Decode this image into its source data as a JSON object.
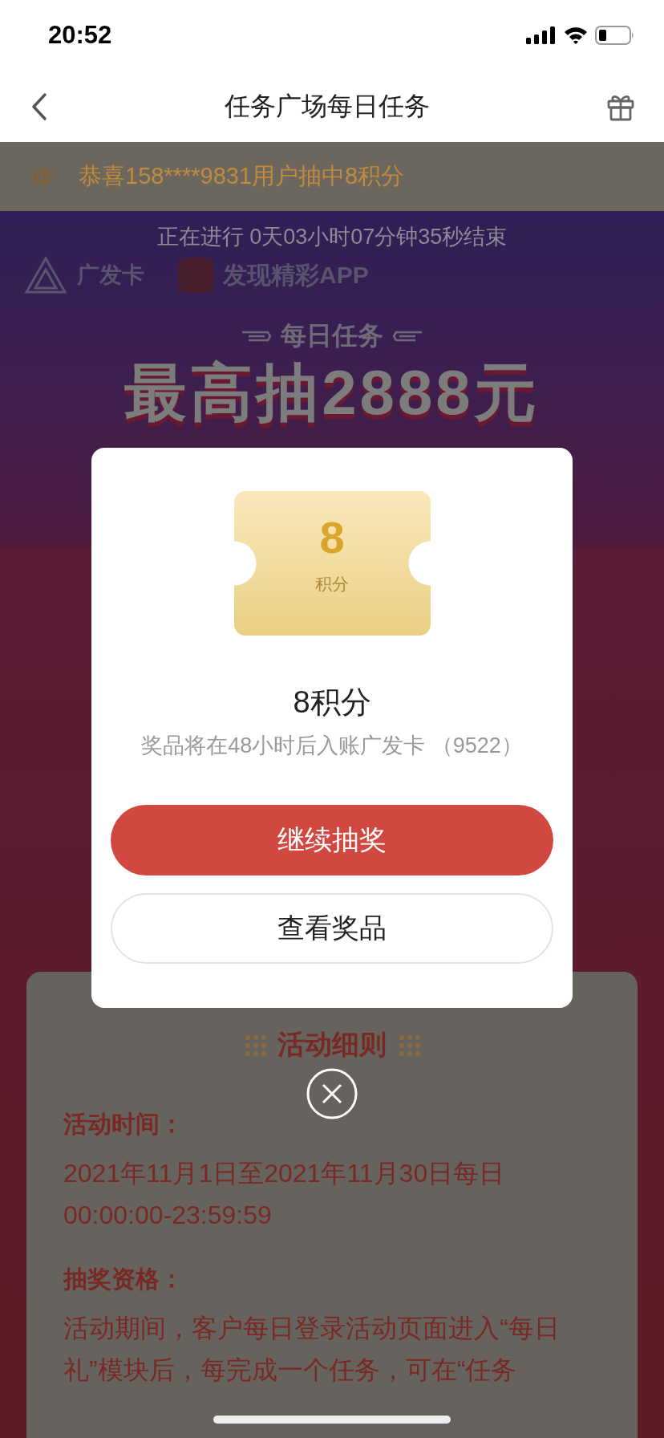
{
  "status_bar": {
    "time": "20:52"
  },
  "nav": {
    "title": "任务广场每日任务"
  },
  "notice": {
    "text": "恭喜158****9831用户抽中8积分"
  },
  "banner": {
    "countdown": "正在进行 0天03小时07分钟35秒结束",
    "brand": "广发卡",
    "app_slogan": "发现精彩APP",
    "subtitle": "每日任务",
    "headline": "最高抽2888元"
  },
  "rules": {
    "title": "活动细则",
    "sections": [
      {
        "heading": "活动时间：",
        "lines": [
          "2021年11月1日至2021年11月30日每日",
          "00:00:00-23:59:59"
        ]
      },
      {
        "heading": "抽奖资格：",
        "lines": [
          "活动期间，客户每日登录活动页面进入“每日",
          "礼”模块后，每完成一个任务，可在“任务"
        ]
      }
    ]
  },
  "dialog": {
    "ticket_value": "8",
    "ticket_unit": "积分",
    "title": "8积分",
    "note": "奖品将在48小时后入账广发卡 （9522）",
    "buttons": [
      {
        "label": "继续抽奖",
        "kind": "primary"
      },
      {
        "label": "查看奖品",
        "kind": "secondary"
      }
    ]
  }
}
